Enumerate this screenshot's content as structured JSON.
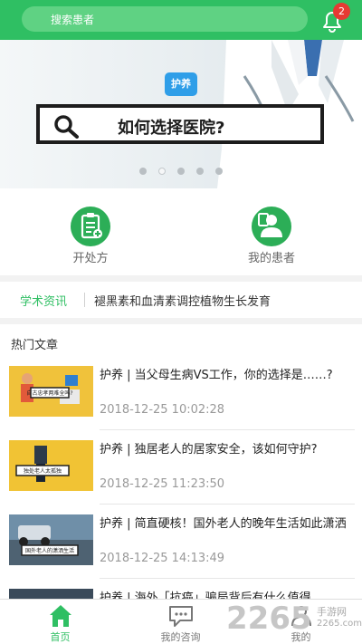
{
  "search": {
    "placeholder": "搜索患者"
  },
  "notifications": {
    "count": "2"
  },
  "banner": {
    "tag": "护养",
    "headline": "如何选择医院?",
    "dots": 5,
    "active_dot": 2
  },
  "shortcuts": [
    {
      "label": "开处方",
      "icon": "prescription-icon"
    },
    {
      "label": "我的患者",
      "icon": "patient-icon"
    }
  ],
  "news": {
    "label": "学术资讯",
    "headline": "褪黑素和血清素调控植物生长发育"
  },
  "articles": {
    "title": "热门文章",
    "items": [
      {
        "title": "护养 | 当父母生病VS工作，你的选择是……?",
        "date": "2018-12-25 10:02:28",
        "thumb_caption": "自古忠孝两难全吗?"
      },
      {
        "title": "护养 | 独居老人的居家安全，该如何守护?",
        "date": "2018-12-25 11:23:50",
        "thumb_caption": "独处老人太孤独"
      },
      {
        "title": "护养 | 简直硬核！国外老人的晚年生活如此潇洒",
        "date": "2018-12-25 14:13:49",
        "thumb_caption": "国外老人的潇洒生活"
      },
      {
        "title": "护养 | 海外「抗癌」骗局背后有什么值得",
        "date": "",
        "thumb_caption": ""
      }
    ]
  },
  "tabbar": [
    {
      "label": "首页",
      "icon": "home-icon",
      "active": true
    },
    {
      "label": "我的咨询",
      "icon": "chat-icon",
      "active": false
    },
    {
      "label": "我的",
      "icon": "profile-icon",
      "active": false
    }
  ],
  "watermark": {
    "number": "2265",
    "site": "手游网",
    "url": "2265.com"
  },
  "colors": {
    "primary": "#2fbf63",
    "badge": "#e63a33",
    "tag": "#2f9ee8"
  }
}
